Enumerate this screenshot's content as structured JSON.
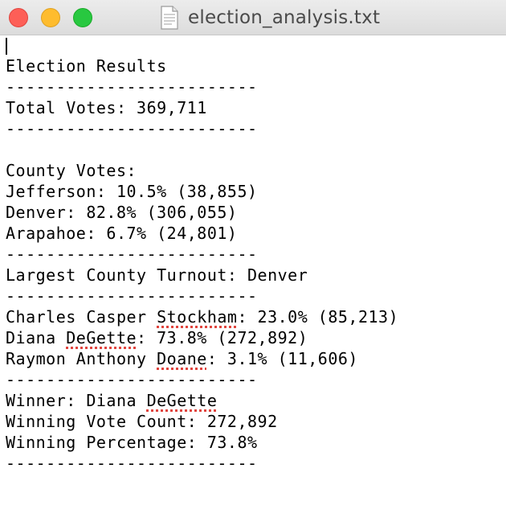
{
  "window": {
    "title": "election_analysis.txt",
    "controls": {
      "close": "close-button",
      "minimize": "minimize-button",
      "zoom": "zoom-button"
    },
    "icon": "text-document-icon"
  },
  "document": {
    "heading": "Election Results",
    "separator": "-------------------------",
    "total_votes": "Total Votes: 369,711",
    "county_votes_header": "County Votes:",
    "county_lines": [
      "Jefferson: 10.5% (38,855)",
      "Denver: 82.8% (306,055)",
      "Arapahoe: 6.7% (24,801)"
    ],
    "largest_county": "Largest County Turnout: Denver",
    "candidates": [
      {
        "prefix": "Charles Casper ",
        "flagged": "Stockham",
        "suffix": ": 23.0% (85,213)"
      },
      {
        "prefix": "Diana ",
        "flagged": "DeGette",
        "suffix": ": 73.8% (272,892)"
      },
      {
        "prefix": "Raymon Anthony ",
        "flagged": "Doane",
        "suffix": ": 3.1% (11,606)"
      }
    ],
    "winner": {
      "prefix": "Winner: Diana ",
      "flagged": "DeGette"
    },
    "winning_vote_count": "Winning Vote Count: 272,892",
    "winning_percentage": "Winning Percentage: 73.8%"
  },
  "colors": {
    "close": "#fd5f57",
    "minimize": "#febc2e",
    "zoom": "#28c840",
    "spellcheck_underline": "#e0443e"
  }
}
